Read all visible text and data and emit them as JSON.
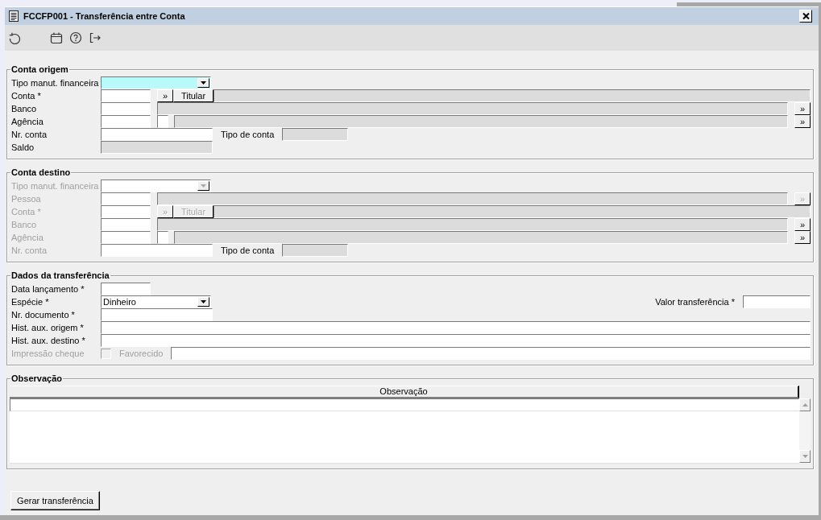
{
  "window": {
    "title": "FCCFP001 - Transferência entre Conta"
  },
  "sections": [
    {
      "legend": "Conta origem",
      "rows": [
        {
          "label": "Tipo manut. financeira",
          "disabled": false,
          "items": [
            {
              "kind": "combo",
              "focused": true,
              "disabled": false
            }
          ]
        },
        {
          "label": "Conta *",
          "disabled": false,
          "items": [
            {
              "kind": "code_input"
            },
            {
              "kind": "lookup",
              "text": "»",
              "disabled": false
            },
            {
              "kind": "button",
              "text": "Titular",
              "disabled": false
            },
            {
              "kind": "fill_display"
            }
          ]
        },
        {
          "label": "Banco",
          "disabled": false,
          "items": [
            {
              "kind": "code_input"
            },
            {
              "kind": "fill_display"
            },
            {
              "kind": "lookup",
              "text": "»",
              "disabled": false
            }
          ]
        },
        {
          "label": "Agência",
          "disabled": false,
          "items": [
            {
              "kind": "code_input"
            },
            {
              "kind": "digit_input"
            },
            {
              "kind": "fill_display"
            },
            {
              "kind": "lookup",
              "text": "»",
              "disabled": false
            }
          ]
        },
        {
          "label": "Nr. conta",
          "disabled": false,
          "items": [
            {
              "kind": "text_input"
            },
            {
              "kind": "label",
              "text": "Tipo de conta",
              "disabled": false
            },
            {
              "kind": "short_display"
            }
          ]
        },
        {
          "label": "Saldo",
          "disabled": false,
          "items": [
            {
              "kind": "text_display"
            }
          ]
        }
      ]
    },
    {
      "legend": "Conta destino",
      "rows": [
        {
          "label": "Tipo manut. financeira",
          "disabled": true,
          "items": [
            {
              "kind": "combo",
              "focused": false,
              "disabled": true
            }
          ]
        },
        {
          "label": "Pessoa",
          "disabled": true,
          "items": [
            {
              "kind": "code_input"
            },
            {
              "kind": "fill_display"
            },
            {
              "kind": "lookup",
              "text": "»",
              "disabled": true
            }
          ]
        },
        {
          "label": "Conta *",
          "disabled": true,
          "items": [
            {
              "kind": "code_input"
            },
            {
              "kind": "lookup",
              "text": "»",
              "disabled": true
            },
            {
              "kind": "button",
              "text": "Titular",
              "disabled": true
            },
            {
              "kind": "fill_display"
            }
          ]
        },
        {
          "label": "Banco",
          "disabled": true,
          "items": [
            {
              "kind": "code_input"
            },
            {
              "kind": "fill_display"
            },
            {
              "kind": "lookup",
              "text": "»",
              "disabled": false
            }
          ]
        },
        {
          "label": "Agência",
          "disabled": true,
          "items": [
            {
              "kind": "code_input"
            },
            {
              "kind": "digit_input"
            },
            {
              "kind": "fill_display"
            },
            {
              "kind": "lookup",
              "text": "»",
              "disabled": false
            }
          ]
        },
        {
          "label": "Nr. conta",
          "disabled": true,
          "items": [
            {
              "kind": "text_input"
            },
            {
              "kind": "label",
              "text": "Tipo de conta",
              "disabled": false
            },
            {
              "kind": "short_display"
            }
          ]
        }
      ]
    },
    {
      "legend": "Dados da transferência",
      "rows": [
        {
          "label": "Data lançamento *",
          "disabled": false,
          "items": [
            {
              "kind": "code_input"
            }
          ]
        },
        {
          "label": "Espécie *",
          "disabled": false,
          "items": [
            {
              "kind": "combo",
              "value": "Dinheiro",
              "focused": false,
              "disabled": false
            },
            {
              "kind": "end_label",
              "text": "Valor transferência *",
              "disabled": false
            },
            {
              "kind": "amount_input"
            }
          ]
        },
        {
          "label": "Nr. documento *",
          "disabled": false,
          "items": [
            {
              "kind": "text_input"
            }
          ]
        },
        {
          "label": "Hist. aux. origem *",
          "disabled": false,
          "items": [
            {
              "kind": "line_input"
            }
          ]
        },
        {
          "label": "Hist. aux. destino *",
          "disabled": false,
          "items": [
            {
              "kind": "line_input"
            }
          ]
        },
        {
          "label": "Impressão cheque",
          "disabled": true,
          "items": [
            {
              "kind": "checkbox",
              "checked": false,
              "disabled": true
            },
            {
              "kind": "label",
              "text": "Favorecido",
              "disabled": true
            },
            {
              "kind": "line_input"
            }
          ]
        }
      ]
    },
    {
      "legend": "Observação",
      "table": {
        "columns": [
          "Observação"
        ]
      }
    }
  ],
  "footer": {
    "buttons": [
      "Gerar transferência"
    ]
  }
}
